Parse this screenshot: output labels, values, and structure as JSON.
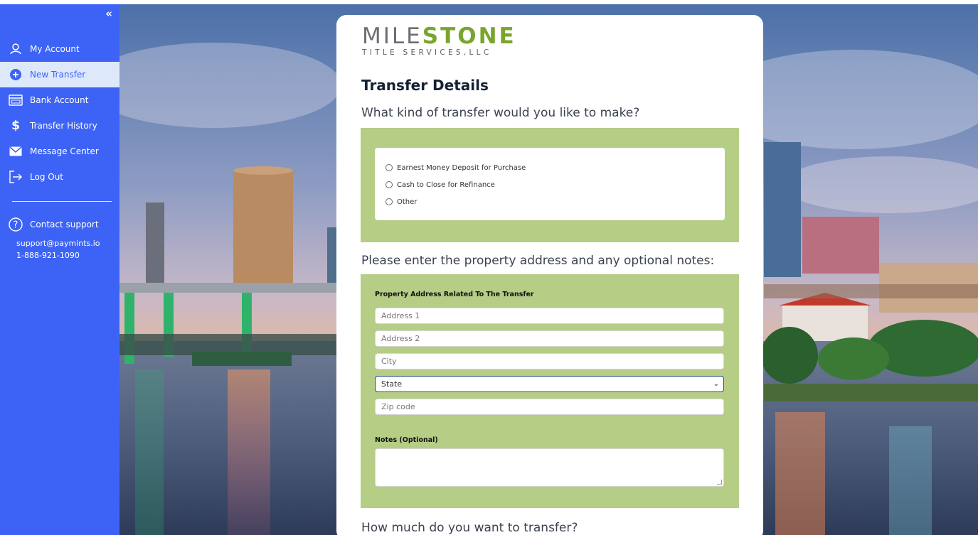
{
  "sidebar": {
    "collapse_label": "«",
    "items": [
      {
        "label": "My Account",
        "icon": "user-icon",
        "active": false
      },
      {
        "label": "New Transfer",
        "icon": "plus-circle-icon",
        "active": true
      },
      {
        "label": "Bank Account",
        "icon": "bank-icon",
        "active": false
      },
      {
        "label": "Transfer History",
        "icon": "dollar-icon",
        "active": false
      },
      {
        "label": "Message Center",
        "icon": "mail-icon",
        "active": false
      },
      {
        "label": "Log Out",
        "icon": "logout-icon",
        "active": false
      }
    ],
    "support": {
      "label": "Contact support",
      "email": "support@paymints.io",
      "phone": "1-888-921-1090"
    }
  },
  "logo": {
    "main_left": "MILE",
    "main_right": "STONE",
    "sub": "TITLE SERVICES,LLC"
  },
  "form": {
    "title": "Transfer Details",
    "question_type": "What kind of transfer would you like to make?",
    "transfer_types": [
      "Earnest Money Deposit for Purchase",
      "Cash to Close for Refinance",
      "Other"
    ],
    "question_address": "Please enter the property address and any optional notes:",
    "address_label": "Property Address Related To The Transfer",
    "address1_placeholder": "Address 1",
    "address2_placeholder": "Address 2",
    "city_placeholder": "City",
    "state_selected": "State",
    "zip_placeholder": "Zip code",
    "notes_label": "Notes (Optional)",
    "question_amount": "How much do you want to transfer?"
  },
  "colors": {
    "sidebar": "#3d63f6",
    "active_item_bg": "#dde8fb",
    "form_section_bg": "#b5cd85",
    "logo_green": "#7aa52d"
  }
}
